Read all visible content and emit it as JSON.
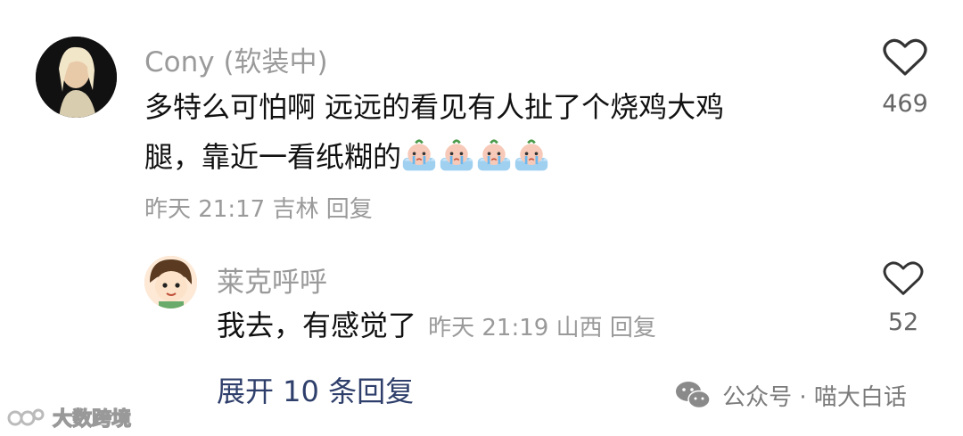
{
  "comments": [
    {
      "author": "Cony (软装中)",
      "text_line1": "多特么可怕啊 远远的看见有人扯了个烧鸡大鸡",
      "text_line2": "腿，靠近一看纸糊的",
      "emoji_count": 4,
      "emoji": "crying-face-emoji",
      "meta": "昨天 21:17 吉林 回复",
      "likes": "469"
    },
    {
      "author": "莱克呼呼",
      "text": "我去，有感觉了",
      "meta": "昨天 21:19 山西 回复",
      "likes": "52"
    }
  ],
  "expand_replies": "展开 10 条回复",
  "watermark_right": "公众号 · 喵大白话",
  "watermark_left": "大数跨境",
  "icons": {
    "like": "heart-outline-icon",
    "wechat": "wechat-icon",
    "logo": "brand-logo-icon"
  },
  "colors": {
    "meta_gray": "#9a9a9a",
    "expand_link": "#2f3f6b"
  }
}
